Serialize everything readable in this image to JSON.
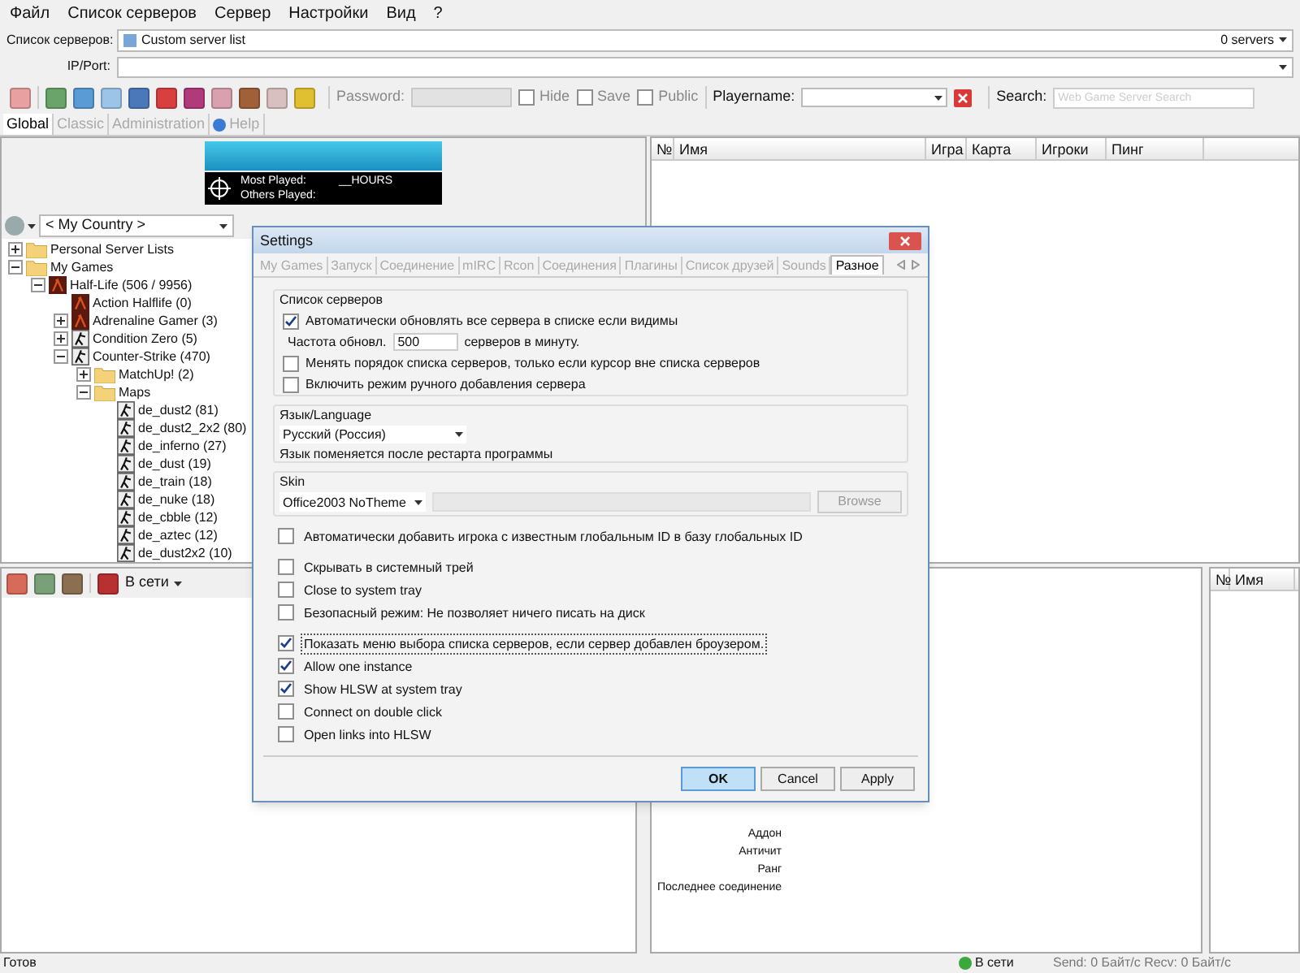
{
  "menu": [
    "Файл",
    "Список серверов",
    "Сервер",
    "Настройки",
    "Вид",
    "?"
  ],
  "server_list": {
    "label": "Список серверов:",
    "value": "Custom server list",
    "count": "0 servers"
  },
  "ip_port": {
    "label": "IP/Port:"
  },
  "toolbar": {
    "password_label": "Password:",
    "options": [
      {
        "label": "Hide",
        "checked": false
      },
      {
        "label": "Save",
        "checked": false
      },
      {
        "label": "Public",
        "checked": false
      }
    ],
    "playername_label": "Playername:",
    "search_label": "Search:",
    "search_placeholder": "Web Game Server Search"
  },
  "tabs": [
    {
      "label": "Global",
      "selected": true
    },
    {
      "label": "Classic",
      "selected": false
    },
    {
      "label": "Administration",
      "selected": false
    },
    {
      "label": "Help",
      "selected": false
    }
  ],
  "banner": {
    "most_played": "Most Played:",
    "hours": "__HOURS",
    "others_played": "Others Played:"
  },
  "country": "< My Country >",
  "tree": [
    {
      "label": "Personal Server Lists",
      "kind": "folder",
      "expanded": false
    },
    {
      "label": "My Games",
      "kind": "folder",
      "expanded": true,
      "children": [
        {
          "label": "Half-Life (506 / 9956)",
          "kind": "game",
          "expanded": true,
          "children": [
            {
              "label": "Action Halflife (0)",
              "kind": "game"
            },
            {
              "label": "Adrenaline Gamer (3)",
              "kind": "game",
              "expanded": false
            },
            {
              "label": "Condition Zero (5)",
              "kind": "cs",
              "expanded": false
            },
            {
              "label": "Counter-Strike (470)",
              "kind": "cs",
              "expanded": true,
              "children": [
                {
                  "label": "MatchUp! (2)",
                  "kind": "folder",
                  "expanded": false
                },
                {
                  "label": "Maps",
                  "kind": "folder",
                  "expanded": true,
                  "children": [
                    {
                      "label": "de_dust2 (81)",
                      "kind": "cs"
                    },
                    {
                      "label": "de_dust2_2x2 (80)",
                      "kind": "cs"
                    },
                    {
                      "label": "de_inferno (27)",
                      "kind": "cs"
                    },
                    {
                      "label": "de_dust (19)",
                      "kind": "cs"
                    },
                    {
                      "label": "de_train (18)",
                      "kind": "cs"
                    },
                    {
                      "label": "de_nuke (18)",
                      "kind": "cs"
                    },
                    {
                      "label": "de_cbble (12)",
                      "kind": "cs"
                    },
                    {
                      "label": "de_aztec (12)",
                      "kind": "cs"
                    },
                    {
                      "label": "de_dust2x2 (10)",
                      "kind": "cs"
                    }
                  ]
                }
              ]
            }
          ]
        }
      ]
    }
  ],
  "server_table": {
    "columns": [
      "№",
      "Имя",
      "Игра",
      "Карта",
      "Игроки",
      "Пинг"
    ]
  },
  "friends_toolbar": {
    "status": "В сети"
  },
  "details": {
    "labels": [
      "Аддон",
      "Античит",
      "Ранг",
      "Последнее соединение"
    ]
  },
  "players_table": {
    "columns": [
      "№",
      "Имя"
    ]
  },
  "status_bar": {
    "text": "Готов",
    "online": "В сети",
    "traffic": "Send: 0 Байт/с Recv: 0 Байт/с"
  },
  "dialog": {
    "title": "Settings",
    "tabs": [
      {
        "label": "My Games",
        "selected": false
      },
      {
        "label": "Запуск",
        "selected": false
      },
      {
        "label": "Соединение",
        "selected": false
      },
      {
        "label": "mIRC",
        "selected": false
      },
      {
        "label": "Rcon",
        "selected": false
      },
      {
        "label": "Соединения",
        "selected": false
      },
      {
        "label": "Плагины",
        "selected": false
      },
      {
        "label": "Список друзей",
        "selected": false
      },
      {
        "label": "Sounds",
        "selected": false
      },
      {
        "label": "Разное",
        "selected": true
      }
    ],
    "server_group": {
      "title": "Список серверов",
      "auto_refresh": {
        "label": "Автоматически обновлять все сервера в списке если видимы",
        "checked": true
      },
      "rate_label": "Частота обновл.",
      "rate_value": "500",
      "rate_unit": "серверов в минуту.",
      "options": [
        {
          "label": "Менять порядок списка серверов, только если курсор вне списка серверов",
          "checked": false
        },
        {
          "label": "Включить режим ручного добавления сервера",
          "checked": false
        }
      ]
    },
    "language_group": {
      "title": "Язык/Language",
      "value": "Русский (Россия)",
      "note": "Язык поменяется после рестарта программы"
    },
    "skin_group": {
      "title": "Skin",
      "value": "Office2003 NoTheme",
      "browse": "Browse"
    },
    "option_groups": [
      [
        {
          "label": "Автоматически добавить игрока с известным глобальным ID в базу глобальных ID",
          "checked": false,
          "focused": false
        }
      ],
      [
        {
          "label": "Скрывать в системный трей",
          "checked": false,
          "focused": false
        },
        {
          "label": "Close to system tray",
          "checked": false,
          "focused": false
        },
        {
          "label": "Безопасный режим: Не позволяет ничего писать на диск",
          "checked": false,
          "focused": false
        }
      ],
      [
        {
          "label": "Показать меню выбора списка серверов, если сервер добавлен броузером.",
          "checked": true,
          "focused": true
        },
        {
          "label": "Allow one instance",
          "checked": true,
          "focused": false
        },
        {
          "label": "Show HLSW at system tray",
          "checked": true,
          "focused": false
        },
        {
          "label": "Connect on double click",
          "checked": false,
          "focused": false
        },
        {
          "label": "Open links into HLSW",
          "checked": false,
          "focused": false
        }
      ]
    ],
    "buttons": [
      {
        "label": "OK",
        "default": true
      },
      {
        "label": "Cancel",
        "default": false
      },
      {
        "label": "Apply",
        "default": false
      }
    ]
  }
}
